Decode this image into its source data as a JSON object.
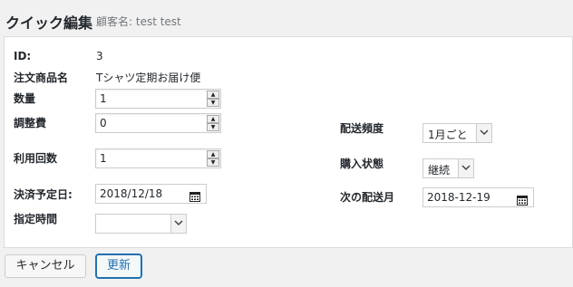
{
  "header": {
    "title": "クイック編集",
    "subtitle": "顧客名: test test"
  },
  "form": {
    "id": {
      "label": "ID:",
      "value": "3"
    },
    "product": {
      "label": "注文商品名",
      "value": "Tシャツ定期お届け便"
    },
    "quantity": {
      "label": "数量",
      "value": "1"
    },
    "adjustment": {
      "label": "調整費",
      "value": "0"
    },
    "usage_count": {
      "label": "利用回数",
      "value": "1"
    },
    "payment_date": {
      "label": "決済予定日:",
      "value": "2018/12/18"
    },
    "time_slot": {
      "label": "指定時間",
      "value": ""
    },
    "frequency": {
      "label": "配送頻度",
      "value": "1月ごと"
    },
    "status": {
      "label": "購入状態",
      "value": "継続"
    },
    "next_delivery": {
      "label": "次の配送月",
      "value": "2018-12-19"
    }
  },
  "buttons": {
    "cancel": "キャンセル",
    "update": "更新"
  },
  "icons": {
    "spinner": "spinner-arrows-icon",
    "calendar": "calendar-icon",
    "dropdown": "chevron-down-icon"
  },
  "colors": {
    "accent": "#2271b1"
  }
}
